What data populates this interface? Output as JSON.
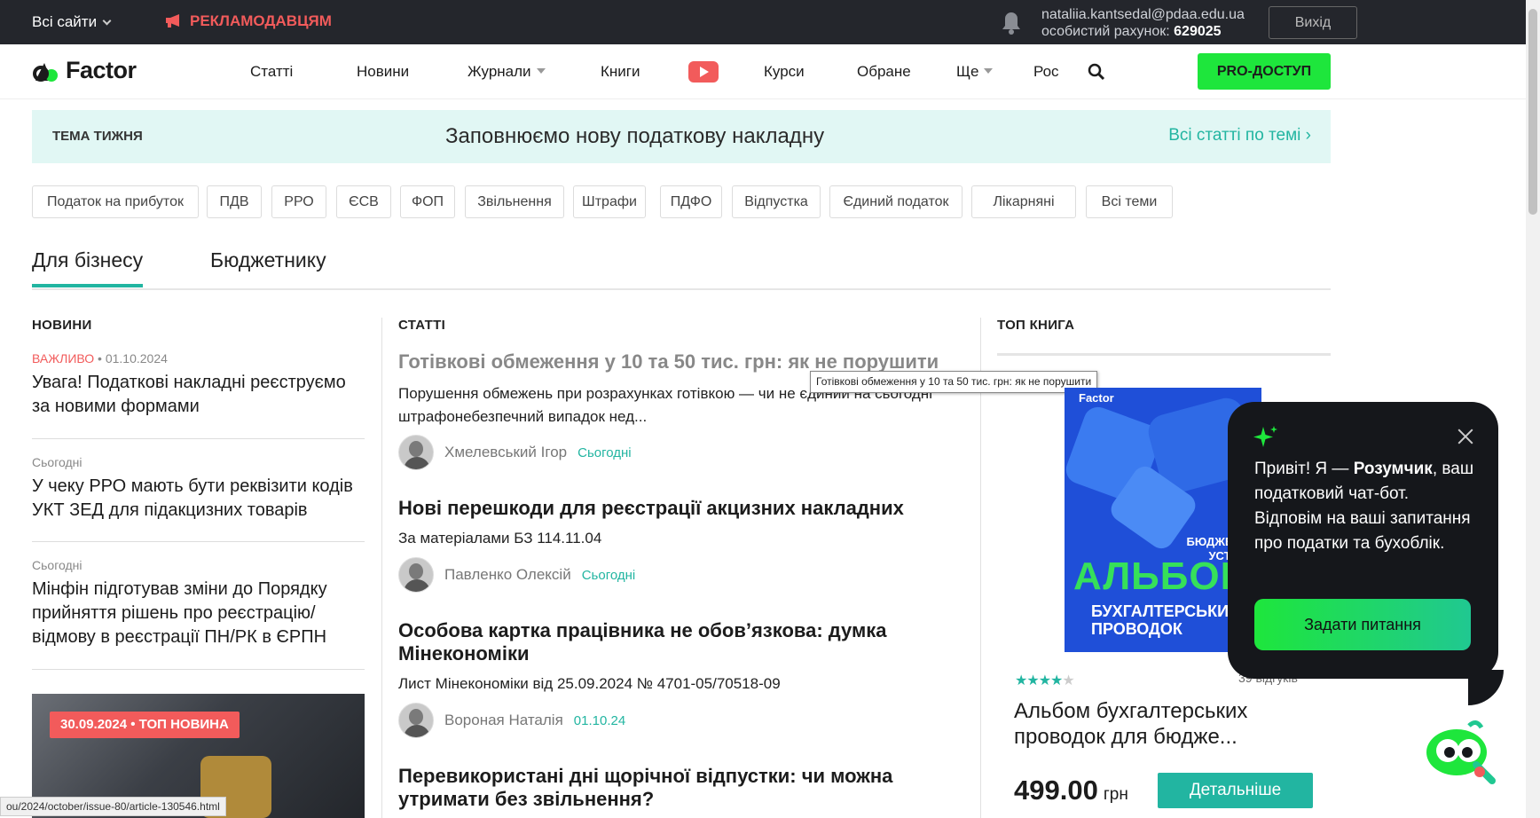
{
  "topbar": {
    "sites_label": "Всі сайти",
    "advertisers_label": "РЕКЛАМОДАВЦЯМ",
    "email": "nataliia.kantsedal@pdaa.edu.ua",
    "account_label": "особистий рахунок:",
    "account_number": "629025",
    "logout_label": "Вихід"
  },
  "nav": {
    "logo_text": "Factor",
    "items": [
      "Статті",
      "Новини",
      "Журнали",
      "Книги",
      "Курси",
      "Обране",
      "Ще",
      "Рос"
    ],
    "pro_label": "PRO-ДОСТУП"
  },
  "theme": {
    "label": "ТЕМА ТИЖНЯ",
    "title": "Заповнюємо нову податкову накладну",
    "all_link": "Всі статті по темі ›"
  },
  "tags": [
    "Податок на прибуток",
    "ПДВ",
    "РРО",
    "ЄСВ",
    "ФОП",
    "Звільнення",
    "Штрафи",
    "ПДФО",
    "Відпустка",
    "Єдиний податок",
    "Лікарняні",
    "Всі теми"
  ],
  "tabs": [
    "Для бізнесу",
    "Бюджетнику"
  ],
  "news": {
    "heading": "НОВИНИ",
    "items": [
      {
        "label": "ВАЖЛИВО",
        "sep": "•",
        "date": "01.10.2024",
        "text": "Увага! Податкові накладні реєструємо за новими формами"
      },
      {
        "label": "",
        "sep": "",
        "date": "Сьогодні",
        "text": "У чеку РРО мають бути реквізити кодів УКТ ЗЕД для підакцизних товарів"
      },
      {
        "label": "",
        "sep": "",
        "date": "Сьогодні",
        "text": "Мінфін підготував зміни до Порядку прийняття рішень про реєстрацію/відмову в реєстрації ПН/РК в ЄРПН"
      }
    ],
    "featured_badge": "30.09.2024  •  ТОП НОВИНА"
  },
  "articles": {
    "heading": "СТАТТІ",
    "items": [
      {
        "title": "Готівкові обмеження у 10 та 50 тис. грн: як не порушити",
        "desc": "Порушення обмежень при розрахунках готівкою — чи не єдиний на сьогодні штрафонебезпечний випадок нед...",
        "author": "Хмелевський Ігор",
        "date": "Сьогодні"
      },
      {
        "title": "Нові перешкоди для реєстрації акцизних накладних",
        "desc": "За матеріалами БЗ 114.11.04",
        "author": "Павленко Олексій",
        "date": "Сьогодні"
      },
      {
        "title": "Особова картка працівника не обов’язкова: думка Мінекономіки",
        "desc": "Лист Мінекономіки від 25.09.2024 № 4701-05/70518-09",
        "author": "Вороная Наталія",
        "date": "01.10.24"
      },
      {
        "title": "Перевикористані дні щорічної відпустки: чи можна утримати без звільнення?",
        "desc": "",
        "author": "",
        "date": ""
      }
    ],
    "tooltip": "Готівкові обмеження у 10 та 50 тис. грн: як не порушити"
  },
  "top_book": {
    "heading": "ТОП КНИГА",
    "cover_brand": "Factor",
    "cover_small": "ДЛЯ БЮДЖЕТНИХ УСТАНОВ",
    "cover_big": "АЛЬБОМ",
    "cover_sub": "БУХГАЛТЕРСЬКИХ ПРОВОДОК",
    "rating": 4.5,
    "reviews": "39 відгуків",
    "title": "Альбом бухгалтерських проводок для бюдже...",
    "price": "499.00",
    "currency": "грн",
    "detail_label": "Детальніше"
  },
  "chat": {
    "greeting_pre": "Привіт! Я — ",
    "bot_name": "Розумчик",
    "greeting_post": ", ваш податковий чат-бот. Відповім на ваші запитання про податки та бухоблік.",
    "ask_label": "Задати питання"
  },
  "status_url": "ou/2024/october/issue-80/article-130546.html",
  "colors": {
    "accent": "#22b5a1",
    "pro": "#1ee63c",
    "important": "#f25b5b",
    "topbar": "#24262c"
  }
}
